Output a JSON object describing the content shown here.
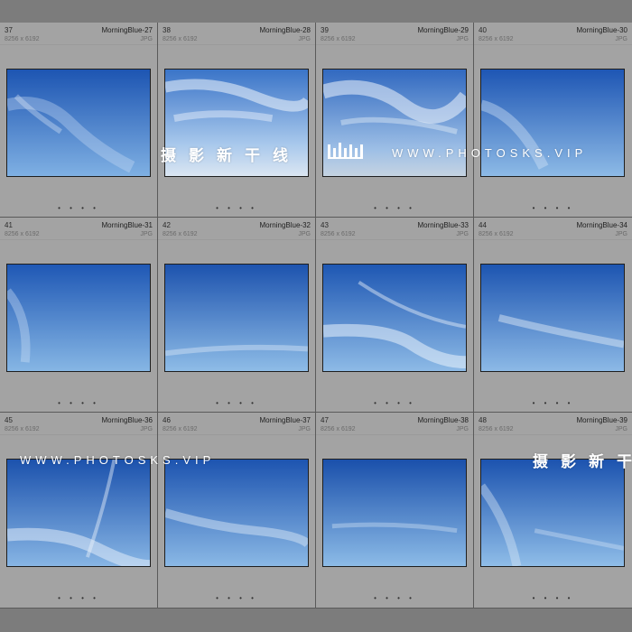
{
  "cells": [
    {
      "num": "37",
      "name": "MorningBlue-27",
      "dims": "8256 x 6192",
      "fmt": "JPG",
      "dots": "• • • •"
    },
    {
      "num": "38",
      "name": "MorningBlue-28",
      "dims": "8256 x 6192",
      "fmt": "JPG",
      "dots": "• • • •"
    },
    {
      "num": "39",
      "name": "MorningBlue-29",
      "dims": "8256 x 6192",
      "fmt": "JPG",
      "dots": "• • • •"
    },
    {
      "num": "40",
      "name": "MorningBlue-30",
      "dims": "8256 x 6192",
      "fmt": "JPG",
      "dots": "• • • •"
    },
    {
      "num": "41",
      "name": "MorningBlue-31",
      "dims": "8256 x 6192",
      "fmt": "JPG",
      "dots": "• • • •"
    },
    {
      "num": "42",
      "name": "MorningBlue-32",
      "dims": "8256 x 6192",
      "fmt": "JPG",
      "dots": "• • • •"
    },
    {
      "num": "43",
      "name": "MorningBlue-33",
      "dims": "8256 x 6192",
      "fmt": "JPG",
      "dots": "• • • •"
    },
    {
      "num": "44",
      "name": "MorningBlue-34",
      "dims": "8256 x 6192",
      "fmt": "JPG",
      "dots": "• • • •"
    },
    {
      "num": "45",
      "name": "MorningBlue-36",
      "dims": "8256 x 6192",
      "fmt": "JPG",
      "dots": "• • • •"
    },
    {
      "num": "46",
      "name": "MorningBlue-37",
      "dims": "8256 x 6192",
      "fmt": "JPG",
      "dots": "• • • •"
    },
    {
      "num": "47",
      "name": "MorningBlue-38",
      "dims": "8256 x 6192",
      "fmt": "JPG",
      "dots": "• • • •"
    },
    {
      "num": "48",
      "name": "MorningBlue-39",
      "dims": "8256 x 6192",
      "fmt": "JPG",
      "dots": "• • • •"
    }
  ],
  "watermark": {
    "cn_text": "摄影新干线",
    "cn_text_partial": "摄影新干",
    "en_text": "WWW.PHOTOSKS.VIP"
  },
  "colors": {
    "cell_bg": "#a3a3a3",
    "sky_top": "#1c54b0",
    "sky_bottom": "#8fbbe6",
    "watermark": "#ffffff"
  }
}
